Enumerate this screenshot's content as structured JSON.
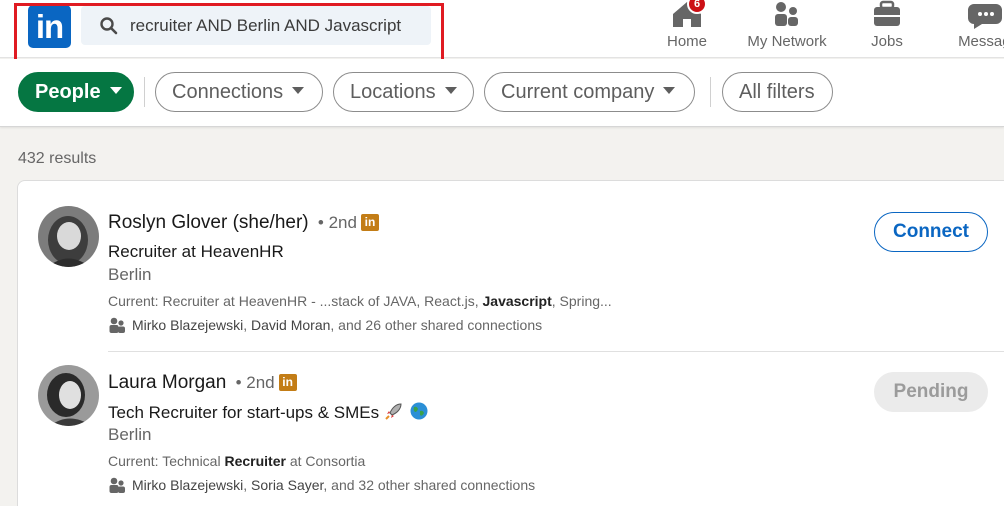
{
  "nav": {
    "search_value": "recruiter AND Berlin AND Javascript",
    "home_label": "Home",
    "home_badge": "6",
    "network_label": "My Network",
    "jobs_label": "Jobs",
    "messaging_label": "Messagi",
    "logo_text": "in"
  },
  "filters": {
    "people": "People",
    "connections": "Connections",
    "locations": "Locations",
    "current_company": "Current company",
    "all_filters": "All filters"
  },
  "results": {
    "count": "432 results",
    "items": [
      {
        "name": "Roslyn Glover (she/her)",
        "degree": "• 2nd",
        "premium_badge": "in",
        "headline": "Recruiter at HeavenHR",
        "location": "Berlin",
        "current_prefix": "Current: Recruiter at HeavenHR - ...stack of JAVA, React.js, ",
        "current_bold": "Javascript",
        "current_suffix": ", Spring...",
        "shared_name1": "Mirko Blazejewski",
        "shared_sep": ", ",
        "shared_name2": "David Moran",
        "shared_rest": ", and 26 other shared connections",
        "action": "Connect"
      },
      {
        "name": "Laura Morgan",
        "degree": "• 2nd",
        "premium_badge": "in",
        "headline": "Tech Recruiter for start-ups & SMEs",
        "location": "Berlin",
        "current_prefix": "Current: Technical ",
        "current_bold": "Recruiter",
        "current_suffix": " at Consortia",
        "shared_name1": "Mirko Blazejewski",
        "shared_sep": ", ",
        "shared_name2": "Soria Sayer",
        "shared_rest": ", and 32 other shared connections",
        "action": "Pending"
      }
    ]
  },
  "colors": {
    "brand": "#0a66c2",
    "people_pill": "#057642",
    "highlight": "#e01b22",
    "premium": "#c37d16"
  }
}
